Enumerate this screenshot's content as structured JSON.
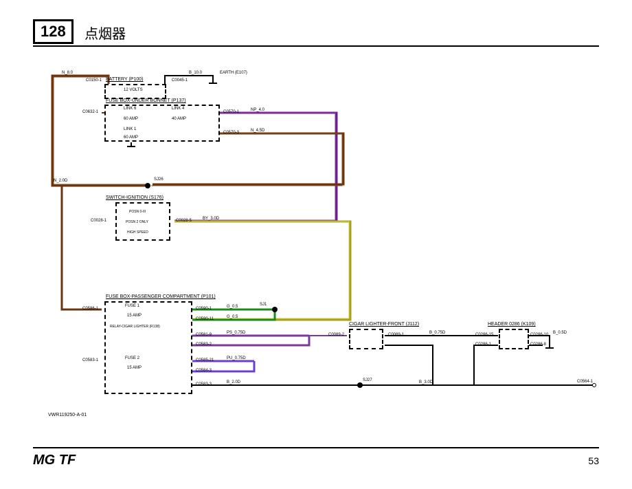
{
  "header": {
    "diagram_number": "128",
    "title": "点烟器"
  },
  "footer": {
    "model": "MG TF",
    "page": "53"
  },
  "drawing_number": "VWR119250-A-01",
  "components": {
    "battery": {
      "label": "BATTERY (P100)",
      "rating": "12 VOLTS"
    },
    "fuse_box_bonnet": {
      "label": "FUSE BOX-UNDER BONNET (P137)",
      "links": [
        {
          "name": "LINK 6",
          "rating": "60 AMP"
        },
        {
          "name": "LINK 4",
          "rating": "40 AMP"
        },
        {
          "name": "LINK 1",
          "rating": "60 AMP"
        }
      ]
    },
    "switch_ignition": {
      "label": "SWITCH-IGNITION (S176)",
      "positions": "POSN 0-III",
      "note": "POSN 2 ONLY",
      "desc": "HIGH SPEED"
    },
    "fuse_box_passenger": {
      "label": "FUSE BOX-PASSENGER COMPARTMENT (P101)",
      "fuses": [
        {
          "name": "FUSE 1",
          "rating": "15 AMP"
        },
        {
          "name": "FUSE 2",
          "rating": "15 AMP"
        }
      ],
      "relay": {
        "name": "RELAY-CIGAR LIGHTER (R138)"
      }
    },
    "cigar_lighter": {
      "label": "CIGAR LIGHTER-FRONT (J112)"
    },
    "header_0286": {
      "label": "HEADER 0286 (K109)"
    }
  },
  "connectors": {
    "c0150_1": "C0150-1",
    "c0045_1": "C0045-1",
    "c0632_1": "C0632-1",
    "c0570_1": "C0570-1",
    "c0570_3": "C0570-3",
    "c0028_1": "C0028-1",
    "c0028_5": "C0028-5",
    "c0586_1": "C0586-1",
    "c0583_1": "C0583-1",
    "c0590_1": "C0590-1",
    "c0590_11": "C0590-11",
    "c0581_9": "C0581-9",
    "c0583_2": "C0583-2",
    "c0585_21": "C0585-21",
    "c0584_3": "C0584-3",
    "c0583_3": "C0583-3",
    "c0089_2": "C0089-2",
    "c0089_1": "C0089-1",
    "c0286_15": "C0286-15",
    "c0286_10": "C0286-10",
    "c0286_1": "C0286-1",
    "c0286_8": "C0286-8",
    "c0564_1": "C0564-1"
  },
  "wires": {
    "n_8_0": "N_8.0",
    "b_10_0": "B_10.0",
    "earth_e107": "EARTH (E107)",
    "np_4_0": "NP_4.0",
    "n_4_5d": "N_4.5D",
    "n_2_0d": "N_2.0D",
    "by_3_0d": "BY_3.0D",
    "g_0_5": "G_0.5",
    "g_0_5b": "G_0.5",
    "ps_0_75d": "PS_0.75D",
    "pu_0_75d": "PU_0.75D",
    "b_2_0d": "B_2.0D",
    "b_0_75d": "B_0.75D",
    "b_0_5d": "B_0.5D",
    "b_3_0d": "B_3.0D"
  },
  "splices": {
    "sj26": "SJ26",
    "sj1": "SJ1",
    "sj27": "SJ27"
  }
}
